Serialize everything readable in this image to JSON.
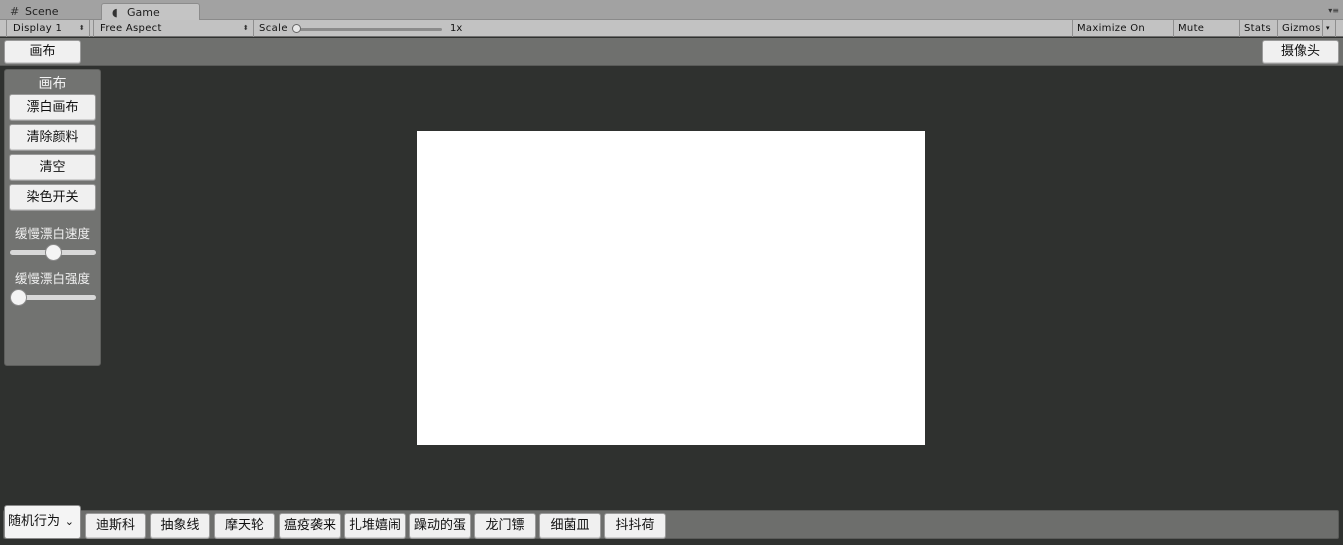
{
  "tabs": {
    "scene": {
      "icon": "grid-icon",
      "label": "Scene"
    },
    "game": {
      "icon": "pacman-icon",
      "label": "Game"
    }
  },
  "toolbar": {
    "display": "Display 1",
    "aspect": "Free Aspect",
    "scale_label": "Scale",
    "scale_value": "1x",
    "maximize_on_play": "Maximize On Play",
    "mute_audio": "Mute Audio",
    "stats": "Stats",
    "gizmos": "Gizmos"
  },
  "topbar": {
    "canvas_button": "画布",
    "camera_button": "摄像头"
  },
  "panel": {
    "title": "画布",
    "buttons": [
      "漂白画布",
      "清除颜料",
      "清空",
      "染色开关"
    ],
    "sliders": [
      {
        "label": "缓慢漂白速度",
        "value": 0.5
      },
      {
        "label": "缓慢漂白强度",
        "value": 0.0
      }
    ]
  },
  "bottombar": {
    "dropdown": "随机行为",
    "buttons": [
      "迪斯科",
      "抽象线",
      "摩天轮",
      "瘟疫袭来",
      "扎堆嬉闹",
      "躁动的蛋",
      "龙门镖",
      "细菌皿",
      "抖抖荷"
    ]
  },
  "colors": {
    "viewport_bg": "#2f312f",
    "canvas": "#ffffff",
    "panel": "#727371"
  }
}
